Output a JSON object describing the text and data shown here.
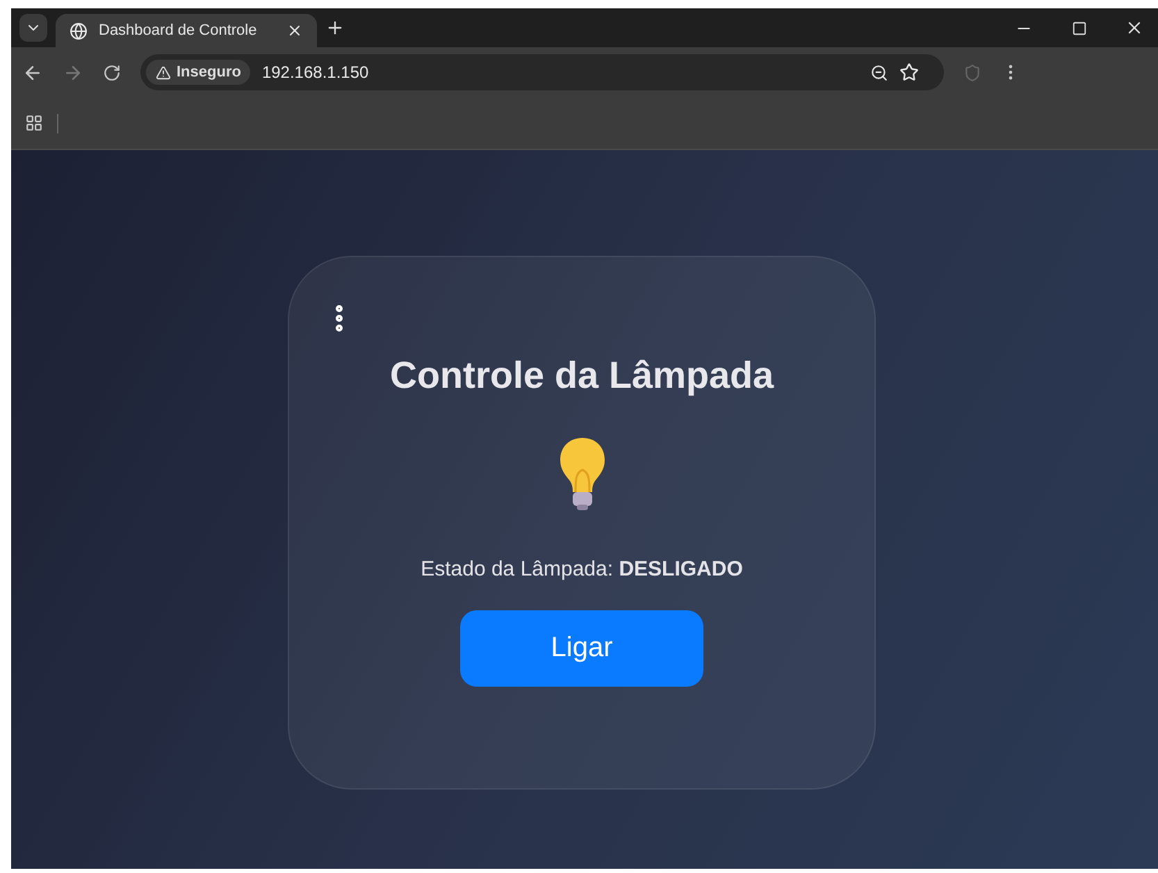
{
  "browser": {
    "tab_title": "Dashboard de Controle",
    "security_label": "Inseguro",
    "address": "192.168.1.150"
  },
  "card": {
    "title": "Controle da Lâmpada",
    "status": "Estado da Lâmpada: **DESLIGADO**",
    "button": "Ligar"
  }
}
